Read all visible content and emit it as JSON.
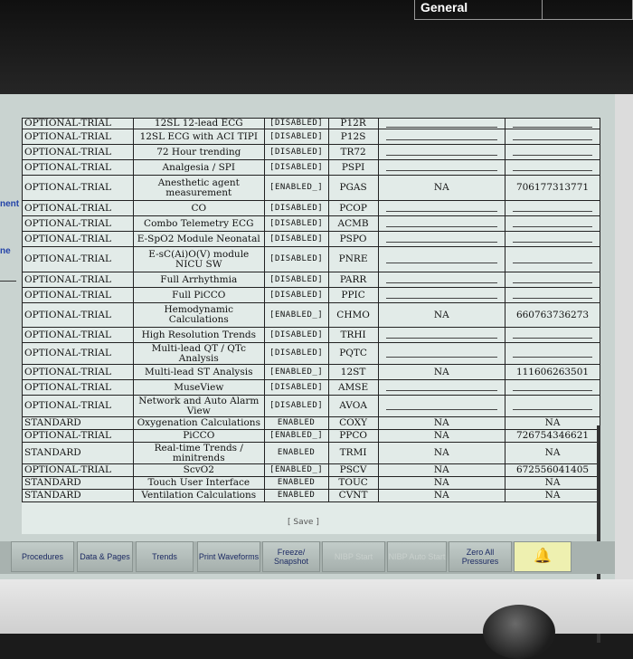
{
  "header": {
    "tab_label": "General"
  },
  "left_pane": {
    "frag1": "nent",
    "frag2": "ne"
  },
  "rows": [
    {
      "type": "OPTIONAL-TRIAL",
      "option": "12SL 12-lead ECG",
      "status": "[DISABLED]",
      "code": "P12R",
      "key1": "",
      "key2": ""
    },
    {
      "type": "OPTIONAL-TRIAL",
      "option": "12SL ECG with ACI TIPI",
      "status": "[DISABLED]",
      "code": "P12S",
      "key1": "",
      "key2": ""
    },
    {
      "type": "OPTIONAL-TRIAL",
      "option": "72 Hour trending",
      "status": "[DISABLED]",
      "code": "TR72",
      "key1": "",
      "key2": ""
    },
    {
      "type": "OPTIONAL-TRIAL",
      "option": "Analgesia / SPI",
      "status": "[DISABLED]",
      "code": "PSPI",
      "key1": "",
      "key2": ""
    },
    {
      "type": "OPTIONAL-TRIAL",
      "option": "Anesthetic agent measurement",
      "status": "[ENABLED_]",
      "code": "PGAS",
      "key1": "NA",
      "key2": "706177313771"
    },
    {
      "type": "OPTIONAL-TRIAL",
      "option": "CO",
      "status": "[DISABLED]",
      "code": "PCOP",
      "key1": "",
      "key2": ""
    },
    {
      "type": "OPTIONAL-TRIAL",
      "option": "Combo Telemetry ECG",
      "status": "[DISABLED]",
      "code": "ACMB",
      "key1": "",
      "key2": ""
    },
    {
      "type": "OPTIONAL-TRIAL",
      "option": "E-SpO2 Module Neonatal",
      "status": "[DISABLED]",
      "code": "PSPO",
      "key1": "",
      "key2": ""
    },
    {
      "type": "OPTIONAL-TRIAL",
      "option": "E-sC(Ai)O(V) module NICU SW",
      "status": "[DISABLED]",
      "code": "PNRE",
      "key1": "",
      "key2": ""
    },
    {
      "type": "OPTIONAL-TRIAL",
      "option": "Full Arrhythmia",
      "status": "[DISABLED]",
      "code": "PARR",
      "key1": "",
      "key2": ""
    },
    {
      "type": "OPTIONAL-TRIAL",
      "option": "Full PiCCO",
      "status": "[DISABLED]",
      "code": "PPIC",
      "key1": "",
      "key2": ""
    },
    {
      "type": "OPTIONAL-TRIAL",
      "option": "Hemodynamic Calculations",
      "status": "[ENABLED_]",
      "code": "CHMO",
      "key1": "NA",
      "key2": "660763736273"
    },
    {
      "type": "OPTIONAL-TRIAL",
      "option": "High Resolution Trends",
      "status": "[DISABLED]",
      "code": "TRHI",
      "key1": "",
      "key2": ""
    },
    {
      "type": "OPTIONAL-TRIAL",
      "option": "Multi-lead QT / QTc Analysis",
      "status": "[DISABLED]",
      "code": "PQTC",
      "key1": "",
      "key2": ""
    },
    {
      "type": "OPTIONAL-TRIAL",
      "option": "Multi-lead ST Analysis",
      "status": "[ENABLED_]",
      "code": "12ST",
      "key1": "NA",
      "key2": "111606263501"
    },
    {
      "type": "OPTIONAL-TRIAL",
      "option": "MuseView",
      "status": "[DISABLED]",
      "code": "AMSE",
      "key1": "",
      "key2": ""
    },
    {
      "type": "OPTIONAL-TRIAL",
      "option": "Network and Auto Alarm View",
      "status": "[DISABLED]",
      "code": "AVOA",
      "key1": "",
      "key2": ""
    },
    {
      "type": "STANDARD",
      "option": "Oxygenation Calculations",
      "status": "ENABLED",
      "code": "COXY",
      "key1": "NA",
      "key2": "NA"
    },
    {
      "type": "OPTIONAL-TRIAL",
      "option": "PiCCO",
      "status": "[ENABLED_]",
      "code": "PPCO",
      "key1": "NA",
      "key2": "726754346621"
    },
    {
      "type": "STANDARD",
      "option": "Real-time Trends / minitrends",
      "status": "ENABLED",
      "code": "TRMI",
      "key1": "NA",
      "key2": "NA"
    },
    {
      "type": "OPTIONAL-TRIAL",
      "option": "ScvO2",
      "status": "[ENABLED_]",
      "code": "PSCV",
      "key1": "NA",
      "key2": "672556041405"
    },
    {
      "type": "STANDARD",
      "option": "Touch User Interface",
      "status": "ENABLED",
      "code": "TOUC",
      "key1": "NA",
      "key2": "NA"
    },
    {
      "type": "STANDARD",
      "option": "Ventilation Calculations",
      "status": "ENABLED",
      "code": "CVNT",
      "key1": "NA",
      "key2": "NA"
    }
  ],
  "save_label": "[ Save ]",
  "buttons": [
    {
      "label": "Procedures",
      "disabled": false
    },
    {
      "label": "Data & Pages",
      "disabled": false
    },
    {
      "label": "Trends",
      "disabled": false
    },
    {
      "label": "Print Waveforms",
      "disabled": false
    },
    {
      "label": "Freeze/ Snapshot",
      "disabled": false
    },
    {
      "label": "NIBP Start",
      "disabled": true
    },
    {
      "label": "NIBP Auto Start",
      "disabled": true
    },
    {
      "label": "Zero All Pressures",
      "disabled": false
    }
  ],
  "colors": {
    "panel": "#e2ebe8",
    "text": "#111111",
    "button_text": "#1c2a63",
    "alarm_button": "#eef0b0"
  }
}
